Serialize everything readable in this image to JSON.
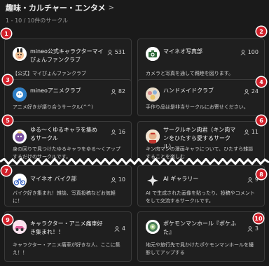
{
  "header": {
    "title": "趣味・カルチャー・エンタメ"
  },
  "subheading": "1 - 10 / 10件のサークル",
  "cards": [
    {
      "badge": "1",
      "name": "mineo公式キャラクターマイぴょんファンクラブ",
      "members": "531",
      "description": "【公式】マイぴょんファンクラブ",
      "icon": "maipyon-avatar-icon"
    },
    {
      "badge": "2",
      "name": "マイネオ写真部",
      "members": "100",
      "description": "カメラと写真を通して親睦を図ります。",
      "icon": "camera-club-avatar-icon"
    },
    {
      "badge": "3",
      "name": "mineoアニメクラブ",
      "members": "82",
      "description": "アニメ好きが語り合うサークル(^^)",
      "icon": "anime-club-avatar-icon"
    },
    {
      "badge": "4",
      "name": "ハンドメイドクラブ",
      "members": "24",
      "description": "手作り品は是非当サークルにお寄せください。",
      "icon": "handmade-club-avatar-icon"
    },
    {
      "badge": "5",
      "name": "ゆる～くゆるキャラを集めるサークル",
      "members": "16",
      "description": "身の回りで見つけたゆるキャラをゆる～くアップするだけのサークルです。",
      "icon": "yurukyara-avatar-icon"
    },
    {
      "badge": "6",
      "name": "サークルキン肉君（キン肉マンをひたすら愛するサークル）",
      "members": "11",
      "description": "キン肉マンの漫画キャラについて、ひたすら雑談することを楽しむ",
      "icon": "kinnikuman-avatar-icon"
    },
    {
      "badge": "7",
      "name": "マイネオ バイク部",
      "members": "10",
      "description": "バイク好き集まれ！雑談、写真投稿などお気軽に！",
      "icon": "bike-club-avatar-icon"
    },
    {
      "badge": "8",
      "name": "AI ギャラリー",
      "members": "9",
      "description": "AI で生成された画像を貼ったり、投稿やコメントをして交流するサークルです。",
      "icon": "ai-gallery-avatar-icon"
    },
    {
      "badge": "9",
      "name": "キャラクター・アニメ痛車好き集まれ！！",
      "members": "4",
      "description": "キャラクター・アニメ痛車が好きな人、ここに集え！！",
      "icon": "itasha-avatar-icon"
    },
    {
      "badge": "10",
      "name": "ポケモンマンホール『ポケふた』",
      "members": "3",
      "description": "地元や旅行先で見かけたポケモンマンホールを撮影してアップする",
      "icon": "pokefuta-avatar-icon"
    }
  ],
  "colors": {
    "background": "#1a1a1a",
    "card": "#1f1f1f",
    "border": "#3a3a3a",
    "badge": "#d0202a"
  }
}
